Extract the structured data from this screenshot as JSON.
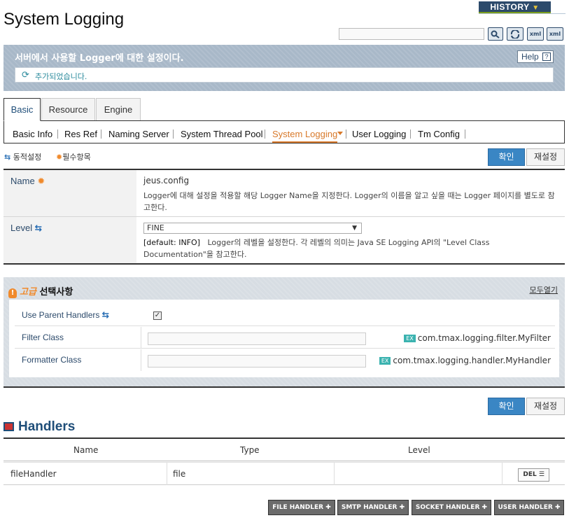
{
  "page": {
    "title": "System Logging"
  },
  "history": {
    "label": "HISTORY"
  },
  "toolbar": {
    "search_placeholder": "",
    "icon1": "xml",
    "icon2": "xml"
  },
  "description": {
    "text": "서버에서 사용할 Logger에 대한 설정이다.",
    "help_label": "Help",
    "message": "추가되었습니다."
  },
  "tabs": [
    {
      "label": "Basic",
      "active": true
    },
    {
      "label": "Resource",
      "active": false
    },
    {
      "label": "Engine",
      "active": false
    }
  ],
  "subnav": [
    {
      "label": "Basic Info"
    },
    {
      "label": "Res Ref"
    },
    {
      "label": "Naming Server"
    },
    {
      "label": "System Thread Pool"
    },
    {
      "label": "System Logging",
      "active": true
    },
    {
      "label": "User Logging"
    },
    {
      "label": "Tm Config"
    }
  ],
  "legend": {
    "dynamic": "동적설정",
    "required": "필수항목"
  },
  "actions": {
    "confirm": "확인",
    "reset": "재설정"
  },
  "form": {
    "name": {
      "label": "Name",
      "value": "jeus.config",
      "help": "Logger에 대해 설정을 적용할 해당 Logger Name을 지정한다. Logger의 이름을 알고 싶을 때는 Logger 페이지를 별도로 참고한다."
    },
    "level": {
      "label": "Level",
      "value": "FINE",
      "default": "[default: INFO]",
      "help": "Logger의 레벨을 설정한다. 각 레벨의 의미는 Java SE Logging API의 \"Level Class Documentation\"을 참고한다."
    }
  },
  "advanced": {
    "title_prefix": "고급",
    "title_rest": " 선택사항",
    "open_all": "모두열기",
    "use_parent_handlers": {
      "label": "Use Parent Handlers",
      "checked": true
    },
    "filter_class": {
      "label": "Filter Class",
      "example": "com.tmax.logging.filter.MyFilter"
    },
    "formatter_class": {
      "label": "Formatter Class",
      "example": "com.tmax.logging.handler.MyHandler"
    },
    "ex_badge": "EX"
  },
  "handlers": {
    "title": "Handlers",
    "columns": [
      "Name",
      "Type",
      "Level"
    ],
    "rows": [
      {
        "name": "fileHandler",
        "type": "file",
        "level": "",
        "action": "DEL"
      }
    ],
    "buttons": [
      "FILE HANDLER",
      "SMTP HANDLER",
      "SOCKET HANDLER",
      "USER HANDLER"
    ]
  },
  "colors": {
    "accent": "#3a86c4",
    "active_tab": "#d8792a",
    "title_blue": "#1f4e79"
  }
}
